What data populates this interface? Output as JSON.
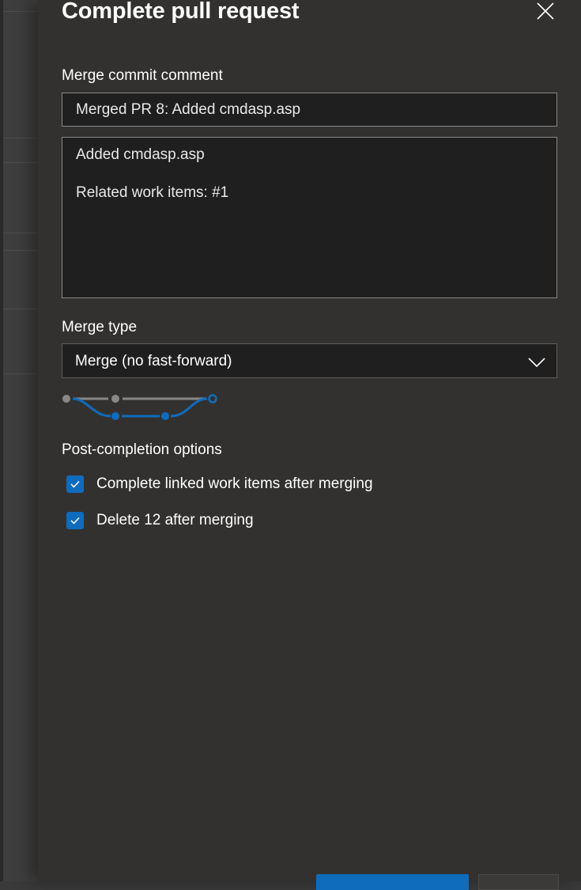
{
  "panel": {
    "title": "Complete pull request"
  },
  "merge_commit": {
    "label": "Merge commit comment",
    "title_value": "Merged PR 8: Added cmdasp.asp",
    "description_lines": [
      "Added cmdasp.asp",
      "",
      "Related work items: #1"
    ]
  },
  "merge_type": {
    "label": "Merge type",
    "selected": "Merge (no fast-forward)"
  },
  "post_completion": {
    "label": "Post-completion options",
    "options": [
      {
        "label": "Complete linked work items after merging",
        "checked": true
      },
      {
        "label": "Delete 12 after merging",
        "checked": true
      }
    ]
  },
  "colors": {
    "accent": "#0f6cbd",
    "panel_bg": "#323130",
    "input_bg": "#1f1f1f"
  },
  "icons": {
    "close": "close-icon",
    "dropdown": "chevron-down-icon",
    "checkbox": "checkmark-icon"
  }
}
